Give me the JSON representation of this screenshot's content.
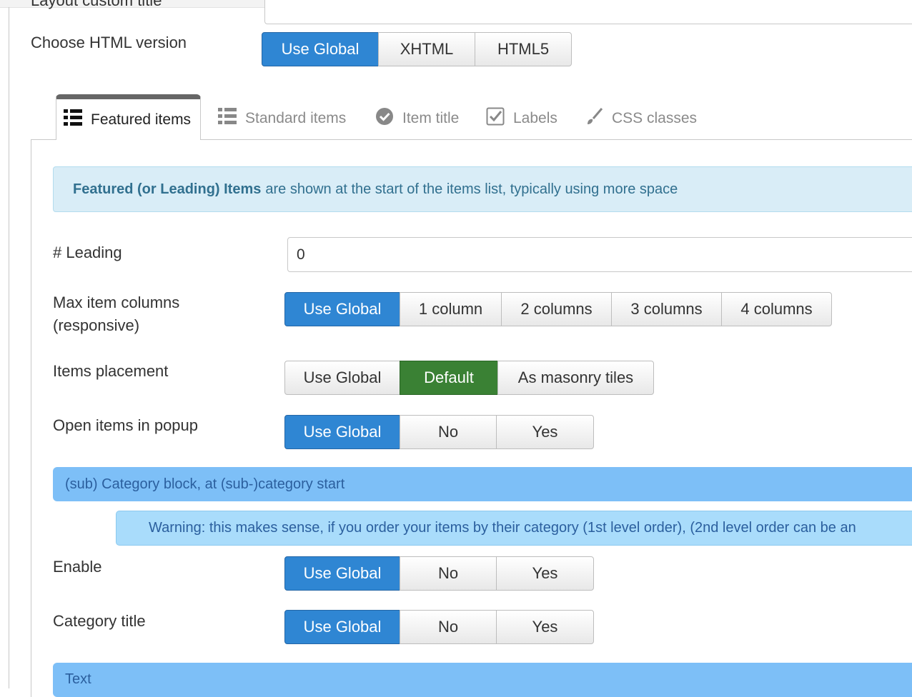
{
  "top": {
    "cut_label": "Layout custom title",
    "html_version_label": "Choose HTML version",
    "html_version_options": [
      "Use Global",
      "XHTML",
      "HTML5"
    ],
    "html_version_selected": "Use Global"
  },
  "tabs": [
    {
      "label": "Featured items",
      "icon": "list-icon",
      "active": true
    },
    {
      "label": "Standard items",
      "icon": "list-icon",
      "active": false
    },
    {
      "label": "Item title",
      "icon": "check-circle-icon",
      "active": false
    },
    {
      "label": "Labels",
      "icon": "checkbox-icon",
      "active": false
    },
    {
      "label": "CSS classes",
      "icon": "brush-icon",
      "active": false
    }
  ],
  "info": {
    "bold": "Featured (or Leading) Items",
    "text": "are shown at the start of the items list, typically using more space"
  },
  "leading": {
    "label": "# Leading",
    "value": "0"
  },
  "columns": {
    "label_line1": "Max item columns",
    "label_line2": "(responsive)",
    "options": [
      "Use Global",
      "1 column",
      "2 columns",
      "3 columns",
      "4 columns"
    ],
    "selected": "Use Global"
  },
  "placement": {
    "label": "Items placement",
    "options": [
      "Use Global",
      "Default",
      "As masonry tiles"
    ],
    "selected": "Default"
  },
  "popup": {
    "label": "Open items in popup",
    "options": [
      "Use Global",
      "No",
      "Yes"
    ],
    "selected": "Use Global"
  },
  "subcat_bar": "(sub) Category block, at (sub-)category start",
  "warning": "Warning: this makes sense, if you order your items by their category (1st level order), (2nd level order can be an",
  "enable": {
    "label": "Enable",
    "options": [
      "Use Global",
      "No",
      "Yes"
    ],
    "selected": "Use Global"
  },
  "cat_title": {
    "label": "Category title",
    "options": [
      "Use Global",
      "No",
      "Yes"
    ],
    "selected": "Use Global"
  },
  "text_bar": "Text",
  "colors": {
    "primary": "#2f86d3",
    "success": "#3a8134",
    "info_bg": "#d9edf7",
    "section_bar": "#7dbff7"
  }
}
